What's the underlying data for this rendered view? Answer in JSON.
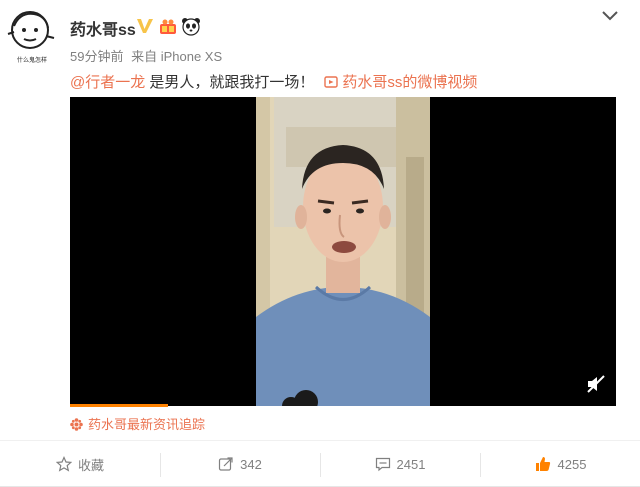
{
  "post": {
    "username": "药水哥ss",
    "time": "59分钟前",
    "source": "来自 iPhone XS",
    "mention": "@行者一龙",
    "text": " 是男人，就跟我打一场！",
    "video_link": "药水哥ss的微博视频",
    "topic": "药水哥最新资讯追踪"
  },
  "avatar": {
    "caption": "什么鬼怎样"
  },
  "actions": {
    "favorite_label": "收藏",
    "repost_count": "342",
    "comment_count": "2451",
    "like_count": "4255"
  },
  "video": {
    "progress": 0.18
  },
  "colors": {
    "accent": "#eb7350",
    "verified": "#f7c44a",
    "progress": "#ff8200"
  },
  "icons": [
    "verified-v-icon",
    "gift-icon",
    "panda-icon",
    "chevron-down-icon",
    "video-link-icon",
    "mute-icon",
    "topic-icon",
    "star-icon",
    "repost-icon",
    "comment-icon",
    "like-icon"
  ]
}
